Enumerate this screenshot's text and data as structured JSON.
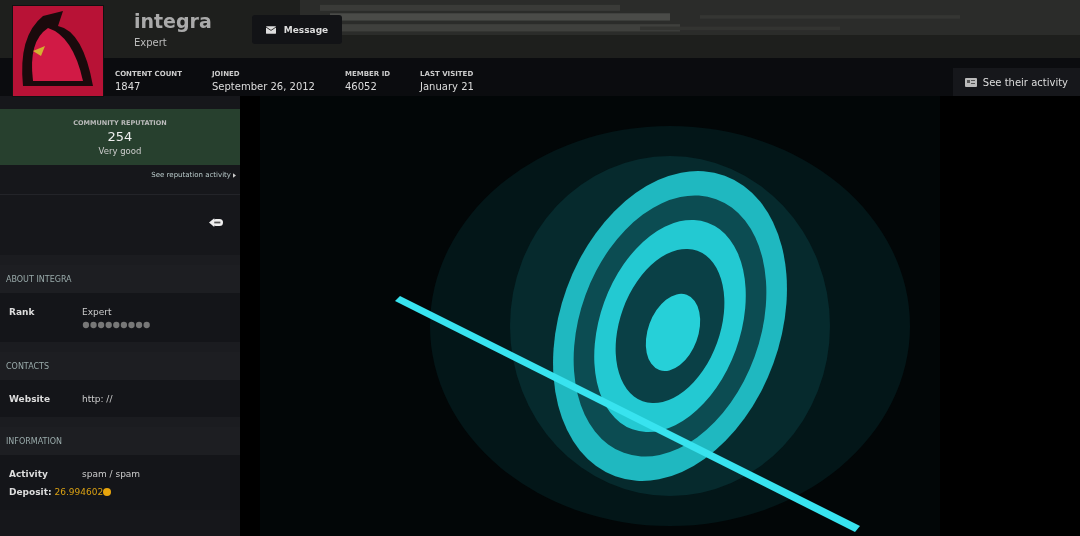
{
  "profile": {
    "name": "integra",
    "rank": "Expert",
    "message_button": "Message",
    "activity_button": "See their activity"
  },
  "stats": [
    {
      "label": "CONTENT COUNT",
      "value": "1847"
    },
    {
      "label": "JOINED",
      "value": "September 26, 2012"
    },
    {
      "label": "MEMBER ID",
      "value": "46052"
    },
    {
      "label": "LAST VISITED",
      "value": "January 21"
    }
  ],
  "reputation": {
    "label": "COMMUNITY REPUTATION",
    "value": "254",
    "description": "Very good",
    "link": "See reputation activity"
  },
  "sections": [
    {
      "title": "ABOUT INTEGRA",
      "rows": [
        {
          "label": "Rank",
          "value": "Expert",
          "kind": "rank"
        }
      ]
    },
    {
      "title": "CONTACTS",
      "rows": [
        {
          "label": "Website",
          "value": "http: //",
          "kind": "text"
        }
      ]
    },
    {
      "title": "INFORMATION",
      "rows": [
        {
          "label": "Activity",
          "value": "spam / spam",
          "kind": "text"
        }
      ]
    }
  ],
  "deposit": {
    "label": "Deposit:",
    "value": "26.994602"
  }
}
